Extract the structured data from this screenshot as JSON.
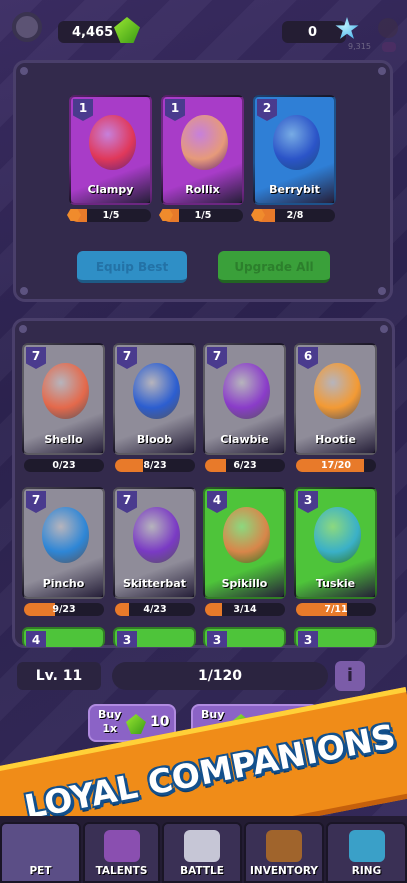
{
  "resources": {
    "coins": "4,465",
    "gems": "0",
    "faded_count": "9,315"
  },
  "equipped": [
    {
      "level": "1",
      "name": "Clampy",
      "progress": "1/5",
      "fill": 0.2,
      "color": "#a83cc8",
      "creature": "#e0385a"
    },
    {
      "level": "1",
      "name": "Rollix",
      "progress": "1/5",
      "fill": 0.2,
      "color": "#a83cc8",
      "creature": "#e69a7a"
    },
    {
      "level": "2",
      "name": "Berrybit",
      "progress": "2/8",
      "fill": 0.25,
      "color": "#2f7fd6",
      "creature": "#2b54c8"
    }
  ],
  "buttons": {
    "equip_best": "Equip Best",
    "upgrade_all": "Upgrade All"
  },
  "collection": [
    {
      "level": "7",
      "name": "Shello",
      "progress": "0/23",
      "fill": 0.0,
      "color": "#8f8c99",
      "creature": "#e4694b"
    },
    {
      "level": "7",
      "name": "Bloob",
      "progress": "8/23",
      "fill": 0.35,
      "color": "#8f8c99",
      "creature": "#2c5ed0"
    },
    {
      "level": "7",
      "name": "Clawbie",
      "progress": "6/23",
      "fill": 0.26,
      "color": "#8f8c99",
      "creature": "#8a3cc9"
    },
    {
      "level": "6",
      "name": "Hootie",
      "progress": "17/20",
      "fill": 0.85,
      "color": "#8f8c99",
      "creature": "#f39a34"
    },
    {
      "level": "7",
      "name": "Pincho",
      "progress": "9/23",
      "fill": 0.39,
      "color": "#8f8c99",
      "creature": "#2e86d6"
    },
    {
      "level": "7",
      "name": "Skitterbat",
      "progress": "4/23",
      "fill": 0.17,
      "color": "#8f8c99",
      "creature": "#7a3ac4"
    },
    {
      "level": "4",
      "name": "Spikillo",
      "progress": "3/14",
      "fill": 0.21,
      "color": "#4ec43a",
      "creature": "#d8864a"
    },
    {
      "level": "3",
      "name": "Tuskie",
      "progress": "7/11",
      "fill": 0.64,
      "color": "#4ec43a",
      "creature": "#3ab0c8"
    }
  ],
  "partial_row": [
    {
      "level": "4",
      "color": "#4ec43a"
    },
    {
      "level": "3",
      "color": "#4ec43a"
    },
    {
      "level": "3",
      "color": "#4ec43a"
    },
    {
      "level": "3",
      "color": "#4ec43a"
    }
  ],
  "level_strip": {
    "level": "Lv. 11",
    "xp": "1/120",
    "info": "i"
  },
  "buy": [
    {
      "label_line1": "Buy",
      "label_line2": "1x",
      "amount": "10"
    },
    {
      "label_line1": "Buy",
      "label_line2": "",
      "amount": ""
    }
  ],
  "promo_banner": "LOYAL COMPANIONS",
  "nav": [
    {
      "label": "PET",
      "icon": "pet-icon",
      "active": true
    },
    {
      "label": "TALENTS",
      "icon": "talents-book-icon",
      "active": false
    },
    {
      "label": "BATTLE",
      "icon": "crossed-swords-icon",
      "active": false
    },
    {
      "label": "INVENTORY",
      "icon": "chest-icon",
      "active": false
    },
    {
      "label": "RING",
      "icon": "globe-ring-icon",
      "active": false
    }
  ]
}
